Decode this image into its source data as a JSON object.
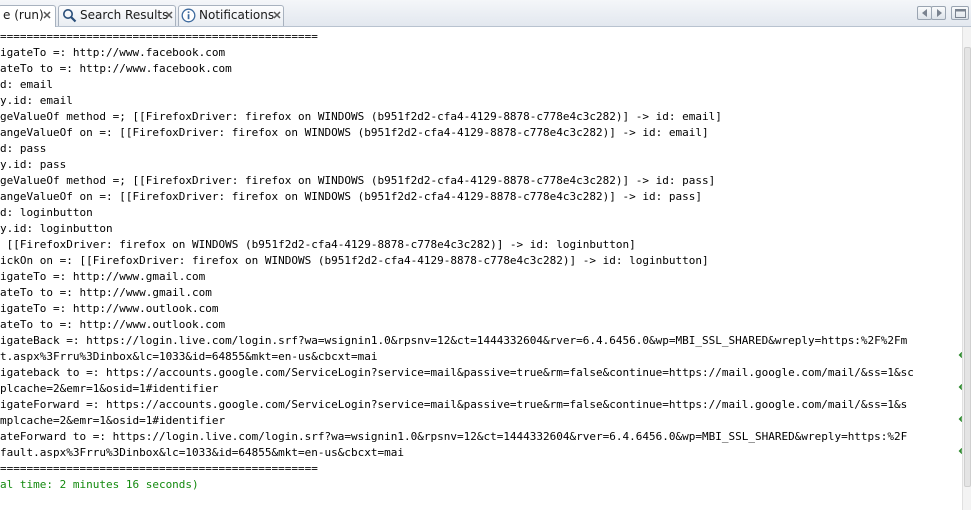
{
  "tabs": [
    {
      "label": "e (run)",
      "icon": "none",
      "active": true
    },
    {
      "label": "Search Results",
      "icon": "magnifier-icon",
      "active": false
    },
    {
      "label": "Notifications",
      "icon": "info-icon",
      "active": false
    }
  ],
  "console_lines": [
    {
      "text": "================================================",
      "color": "black"
    },
    {
      "text": "igateTo =: http://www.facebook.com",
      "color": "black"
    },
    {
      "text": "ateTo to =: http://www.facebook.com",
      "color": "black"
    },
    {
      "text": "d: email",
      "color": "black"
    },
    {
      "text": "y.id: email",
      "color": "black"
    },
    {
      "text": "geValueOf method =; [[FirefoxDriver: firefox on WINDOWS (b951f2d2-cfa4-4129-8878-c778e4c3c282)] -> id: email]",
      "color": "black"
    },
    {
      "text": "angeValueOf on =: [[FirefoxDriver: firefox on WINDOWS (b951f2d2-cfa4-4129-8878-c778e4c3c282)] -> id: email]",
      "color": "black"
    },
    {
      "text": "d: pass",
      "color": "black"
    },
    {
      "text": "y.id: pass",
      "color": "black"
    },
    {
      "text": "geValueOf method =; [[FirefoxDriver: firefox on WINDOWS (b951f2d2-cfa4-4129-8878-c778e4c3c282)] -> id: pass]",
      "color": "black"
    },
    {
      "text": "angeValueOf on =: [[FirefoxDriver: firefox on WINDOWS (b951f2d2-cfa4-4129-8878-c778e4c3c282)] -> id: pass]",
      "color": "black"
    },
    {
      "text": "d: loginbutton",
      "color": "black"
    },
    {
      "text": "y.id: loginbutton",
      "color": "black"
    },
    {
      "text": " [[FirefoxDriver: firefox on WINDOWS (b951f2d2-cfa4-4129-8878-c778e4c3c282)] -> id: loginbutton]",
      "color": "black"
    },
    {
      "text": "ickOn on =: [[FirefoxDriver: firefox on WINDOWS (b951f2d2-cfa4-4129-8878-c778e4c3c282)] -> id: loginbutton]",
      "color": "black"
    },
    {
      "text": "igateTo =: http://www.gmail.com",
      "color": "black"
    },
    {
      "text": "ateTo to =: http://www.gmail.com",
      "color": "black"
    },
    {
      "text": "igateTo =: http://www.outlook.com",
      "color": "black"
    },
    {
      "text": "ateTo to =: http://www.outlook.com",
      "color": "black"
    },
    {
      "text": "igateBack =: https://login.live.com/login.srf?wa=wsignin1.0&rpsnv=12&ct=1444332604&rver=6.4.6456.0&wp=MBI_SSL_SHARED&wreply=https:%2F%2Fm",
      "color": "black"
    },
    {
      "text": "t.aspx%3Frru%3Dinbox&lc=1033&id=64855&mkt=en-us&cbcxt=mai",
      "color": "black",
      "wrapped": true
    },
    {
      "text": "igateback to =: https://accounts.google.com/ServiceLogin?service=mail&passive=true&rm=false&continue=https://mail.google.com/mail/&ss=1&sc",
      "color": "black"
    },
    {
      "text": "plcache=2&emr=1&osid=1#identifier",
      "color": "black",
      "wrapped": true
    },
    {
      "text": "igateForward =: https://accounts.google.com/ServiceLogin?service=mail&passive=true&rm=false&continue=https://mail.google.com/mail/&ss=1&s",
      "color": "black"
    },
    {
      "text": "mplcache=2&emr=1&osid=1#identifier",
      "color": "black",
      "wrapped": true
    },
    {
      "text": "ateForward to =: https://login.live.com/login.srf?wa=wsignin1.0&rpsnv=12&ct=1444332604&rver=6.4.6456.0&wp=MBI_SSL_SHARED&wreply=https:%2F",
      "color": "black"
    },
    {
      "text": "fault.aspx%3Frru%3Dinbox&lc=1033&id=64855&mkt=en-us&cbcxt=mai",
      "color": "black",
      "wrapped": true
    },
    {
      "text": "================================================",
      "color": "black"
    },
    {
      "text": "al time: 2 minutes 16 seconds)",
      "color": "green"
    }
  ]
}
